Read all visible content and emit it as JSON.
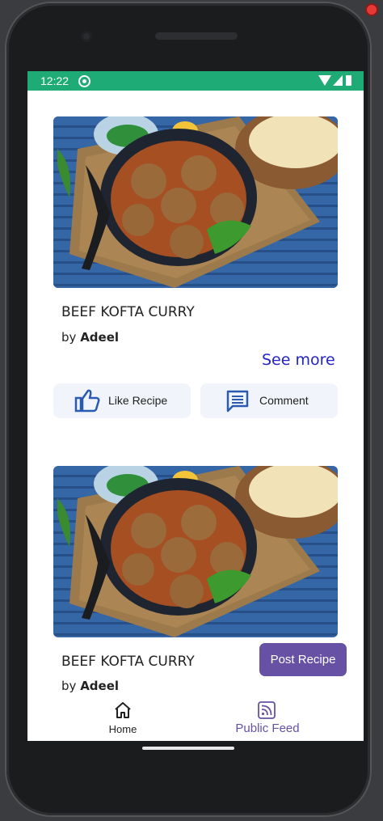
{
  "status_bar": {
    "time": "12:22"
  },
  "cards": [
    {
      "title": "BEEF KOFTA CURRY",
      "author_prefix": "by",
      "author": "Adeel",
      "see_more": "See more"
    },
    {
      "title": "BEEF KOFTA CURRY",
      "author_prefix": "by",
      "author": "Adeel"
    }
  ],
  "actions": {
    "like_label": "Like Recipe",
    "comment_label": "Comment"
  },
  "post_button_label": "Post Recipe",
  "bottom_nav": {
    "items": [
      {
        "label": "Home",
        "icon": "home-icon"
      },
      {
        "label": "Public Feed",
        "icon": "rss-feed-icon",
        "selected": true
      }
    ]
  },
  "colors": {
    "status_bar": "#1eab75",
    "accent": "#6651a4",
    "link": "#2323c9"
  }
}
